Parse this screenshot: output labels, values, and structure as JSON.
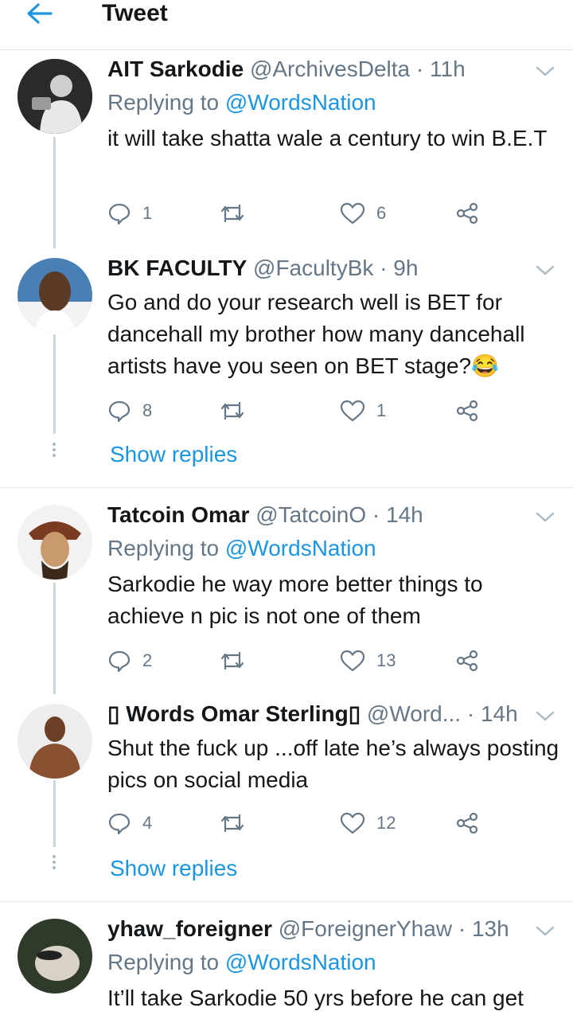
{
  "header": {
    "title": "Tweet"
  },
  "tweets": [
    {
      "name": "AIT Sarkodie",
      "handle": "@ArchivesDelta",
      "time": "11h",
      "replying_prefix": "Replying to ",
      "replying_to": "@WordsNation",
      "text": "it will take shatta wale a century to win B.E.T",
      "replies": "1",
      "retweets": "",
      "likes": "6"
    },
    {
      "name": "BK FACULTY",
      "handle": "@FacultyBk",
      "time": "9h",
      "text": "Go and do your research well is BET for dancehall my brother how many dancehall artists have you seen on BET stage?😂",
      "replies": "8",
      "retweets": "",
      "likes": "1"
    },
    {
      "name": "Tatcoin Omar",
      "handle": "@TatcoinO",
      "time": "14h",
      "replying_prefix": "Replying to ",
      "replying_to": "@WordsNation",
      "text": "Sarkodie he way more better things to achieve n pic is not one of them",
      "replies": "2",
      "retweets": "",
      "likes": "13"
    },
    {
      "name": "▯ Words Omar Sterling▯",
      "handle": "@Word...",
      "time": "14h",
      "text": "Shut the fuck up ...off late he’s always posting pics on social media",
      "replies": "4",
      "retweets": "",
      "likes": "12"
    },
    {
      "name": "yhaw_foreigner",
      "handle": "@ForeignerYhaw",
      "time": "13h",
      "replying_prefix": "Replying to ",
      "replying_to": "@WordsNation",
      "text": "It’ll take Sarkodie 50 yrs before he can get",
      "replies": "",
      "retweets": "",
      "likes": ""
    }
  ],
  "show_replies_label": "Show replies",
  "separator_dot": "·",
  "colors": {
    "accent": "#1b95e0",
    "muted": "#657786",
    "text": "#14171a",
    "border": "#e1e8ed"
  },
  "icons": [
    "back-arrow-icon",
    "caret-down-icon",
    "reply-icon",
    "retweet-icon",
    "like-icon",
    "share-icon"
  ]
}
